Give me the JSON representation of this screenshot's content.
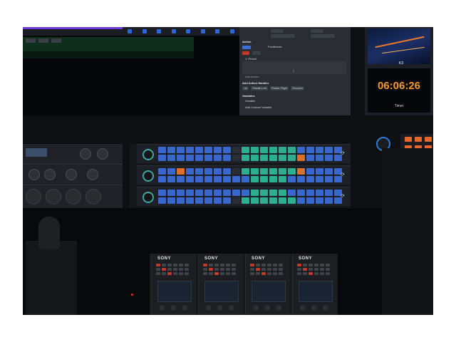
{
  "control_panel": {
    "sections": {
      "action": "Action",
      "add_action_handler": "Add Action Handler",
      "variables": "Variables"
    },
    "fields": {
      "feedbacks_label": "Feedbacks",
      "preset_label": "1: Preset",
      "add_action_placeholder": "Add Action...",
      "variable_label": "Variable",
      "add_custom_variable": "Add Custom Variable"
    },
    "handler_buttons": [
      "Up",
      "Rotate Left",
      "Rotate Right",
      "Encoder"
    ]
  },
  "timer_display": {
    "time": "06:06:26",
    "label": "Timer",
    "monitor_label": "K3"
  },
  "rcp_units": [
    {
      "brand": "SONY"
    },
    {
      "brand": "SONY"
    },
    {
      "brand": "SONY"
    },
    {
      "brand": "SONY"
    }
  ],
  "colors": {
    "pad_blue": "#3e6fe0",
    "pad_teal": "#2fbf9b",
    "pad_orange": "#f07a2c",
    "pad_dark": "#2b2f38",
    "timer_orange": "#f39a2a",
    "accent_purple": "#6b3bd8"
  }
}
